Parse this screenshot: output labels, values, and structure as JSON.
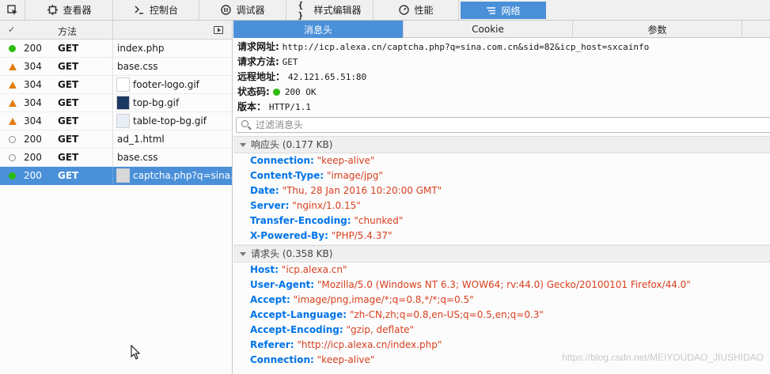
{
  "toolbar": {
    "pick_icon": "element-picker-icon",
    "tabs": [
      {
        "label": "查看器",
        "icon": "inspector-icon"
      },
      {
        "label": "控制台",
        "icon": "console-icon"
      },
      {
        "label": "调试器",
        "icon": "debugger-icon"
      },
      {
        "label": "样式编辑器",
        "icon": "style-editor-icon"
      },
      {
        "label": "性能",
        "icon": "performance-icon"
      },
      {
        "label": "网络",
        "icon": "network-icon"
      }
    ]
  },
  "list": {
    "header": {
      "check": "✓",
      "method": "方法"
    },
    "rows": [
      {
        "status_icon": "green-dot",
        "code": "200",
        "method": "GET",
        "name": "index.php",
        "thumb": ""
      },
      {
        "status_icon": "orange-triangle",
        "code": "304",
        "method": "GET",
        "name": "base.css",
        "thumb": ""
      },
      {
        "status_icon": "orange-triangle",
        "code": "304",
        "method": "GET",
        "name": "footer-logo.gif",
        "thumb": "#ffffff"
      },
      {
        "status_icon": "orange-triangle",
        "code": "304",
        "method": "GET",
        "name": "top-bg.gif",
        "thumb": "#1b3a63"
      },
      {
        "status_icon": "orange-triangle",
        "code": "304",
        "method": "GET",
        "name": "table-top-bg.gif",
        "thumb": "#e8eef5"
      },
      {
        "status_icon": "hollow-dot",
        "code": "200",
        "method": "GET",
        "name": "ad_1.html",
        "thumb": ""
      },
      {
        "status_icon": "hollow-dot",
        "code": "200",
        "method": "GET",
        "name": "base.css",
        "thumb": ""
      },
      {
        "status_icon": "green-dot",
        "code": "200",
        "method": "GET",
        "name": "captcha.php?q=sina.com.cn",
        "thumb": "#d8d8d8"
      }
    ]
  },
  "detail": {
    "subtabs": [
      "消息头",
      "Cookie",
      "参数"
    ],
    "summary": {
      "url_label": "请求网址:",
      "url": "http://icp.alexa.cn/captcha.php?q=sina.com.cn&sid=82&icp_host=sxcainfo",
      "method_label": "请求方法:",
      "method": "GET",
      "remote_label": "远程地址：",
      "remote": "42.121.65.51:80",
      "status_label": "状态码:",
      "status": "200 OK",
      "version_label": "版本：",
      "version": "HTTP/1.1"
    },
    "filter_placeholder": "过滤消息头",
    "response_headers_title": "响应头 (0.177 KB)",
    "response_headers": [
      {
        "key": "Connection:",
        "value": "\"keep-alive\""
      },
      {
        "key": "Content-Type:",
        "value": "\"image/jpg\""
      },
      {
        "key": "Date:",
        "value": "\"Thu, 28 Jan 2016 10:20:00 GMT\""
      },
      {
        "key": "Server:",
        "value": "\"nginx/1.0.15\""
      },
      {
        "key": "Transfer-Encoding:",
        "value": "\"chunked\""
      },
      {
        "key": "X-Powered-By:",
        "value": "\"PHP/5.4.37\""
      }
    ],
    "request_headers_title": "请求头 (0.358 KB)",
    "request_headers": [
      {
        "key": "Host:",
        "value": "\"icp.alexa.cn\""
      },
      {
        "key": "User-Agent:",
        "value": "\"Mozilla/5.0 (Windows NT 6.3; WOW64; rv:44.0) Gecko/20100101 Firefox/44.0\""
      },
      {
        "key": "Accept:",
        "value": "\"image/png,image/*;q=0.8,*/*;q=0.5\""
      },
      {
        "key": "Accept-Language:",
        "value": "\"zh-CN,zh;q=0.8,en-US;q=0.5,en;q=0.3\""
      },
      {
        "key": "Accept-Encoding:",
        "value": "\"gzip, deflate\""
      },
      {
        "key": "Referer:",
        "value": "\"http://icp.alexa.cn/index.php\""
      },
      {
        "key": "Connection:",
        "value": "\"keep-alive\""
      }
    ]
  },
  "watermark": "https://blog.csdn.net/MEIYOUDAO_JIUSHIDAO",
  "colors": {
    "accent": "#4a90d9",
    "header_key": "#0074e8",
    "header_value": "#d7401f",
    "ok": "#2cbb0f",
    "cached": "#e07d10"
  }
}
